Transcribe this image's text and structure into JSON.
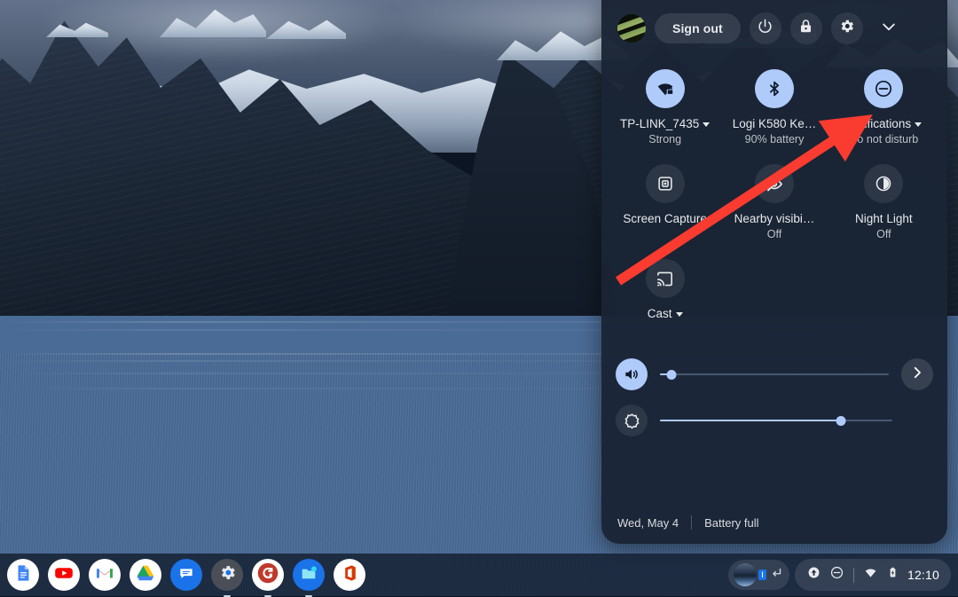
{
  "wallpaper": {
    "alt": "dark mountain lake wallpaper"
  },
  "quick_settings": {
    "header": {
      "avatar": "user-avatar",
      "sign_out_label": "Sign out",
      "power_icon": "power-icon",
      "lock_icon": "lock-icon",
      "settings_icon": "gear-icon",
      "collapse_icon": "chevron-down-icon"
    },
    "tiles": [
      {
        "label": "TP-LINK_7435",
        "sub": "Strong",
        "icon": "wifi-locked-icon",
        "state": "on",
        "caret": true
      },
      {
        "label": "Logi K580 Ke…",
        "sub": "90% battery",
        "icon": "bluetooth-icon",
        "state": "on",
        "caret": false
      },
      {
        "label": "Notifications",
        "sub": "Do not disturb",
        "icon": "do-not-disturb-icon",
        "state": "on",
        "caret": true
      },
      {
        "label": "Screen Capture",
        "sub": "",
        "icon": "screen-capture-icon",
        "state": "off",
        "caret": false
      },
      {
        "label": "Nearby visibi…",
        "sub": "Off",
        "icon": "nearby-visibility-off-icon",
        "state": "off",
        "caret": false
      },
      {
        "label": "Night Light",
        "sub": "Off",
        "icon": "night-light-icon",
        "state": "off",
        "caret": false
      },
      {
        "label": "Cast",
        "sub": "",
        "icon": "cast-icon",
        "state": "off",
        "caret": true
      }
    ],
    "sliders": [
      {
        "name": "volume",
        "icon": "volume-icon",
        "value": 5,
        "state": "on",
        "next_icon": "chevron-right-icon"
      },
      {
        "name": "brightness",
        "icon": "brightness-icon",
        "value": 78,
        "state": "off",
        "next_icon": ""
      }
    ],
    "footer": {
      "date": "Wed, May 4",
      "battery": "Battery full"
    }
  },
  "shelf": {
    "apps": [
      {
        "name": "google-docs",
        "icon": "docs-icon",
        "running": false
      },
      {
        "name": "youtube",
        "icon": "youtube-icon",
        "running": false
      },
      {
        "name": "gmail",
        "icon": "gmail-icon",
        "running": false
      },
      {
        "name": "google-drive",
        "icon": "drive-icon",
        "running": false
      },
      {
        "name": "messages",
        "icon": "messages-icon",
        "running": false
      },
      {
        "name": "settings",
        "icon": "settings-icon",
        "running": true
      },
      {
        "name": "grammarly",
        "icon": "grammarly-icon",
        "running": true
      },
      {
        "name": "files",
        "icon": "files-icon",
        "running": true
      },
      {
        "name": "office",
        "icon": "office-icon",
        "running": false
      }
    ],
    "tray": {
      "ime_label": "ו",
      "ime_icon": "ime-indicator-icon",
      "return_icon": "return-key-icon",
      "upload_icon": "upload-status-icon",
      "dnd_icon": "do-not-disturb-icon",
      "wifi_icon": "wifi-icon",
      "battery_icon": "battery-full-icon",
      "time": "12:10"
    }
  },
  "annotation": {
    "arrow_color": "#f93b30",
    "points_to": "Notifications"
  }
}
